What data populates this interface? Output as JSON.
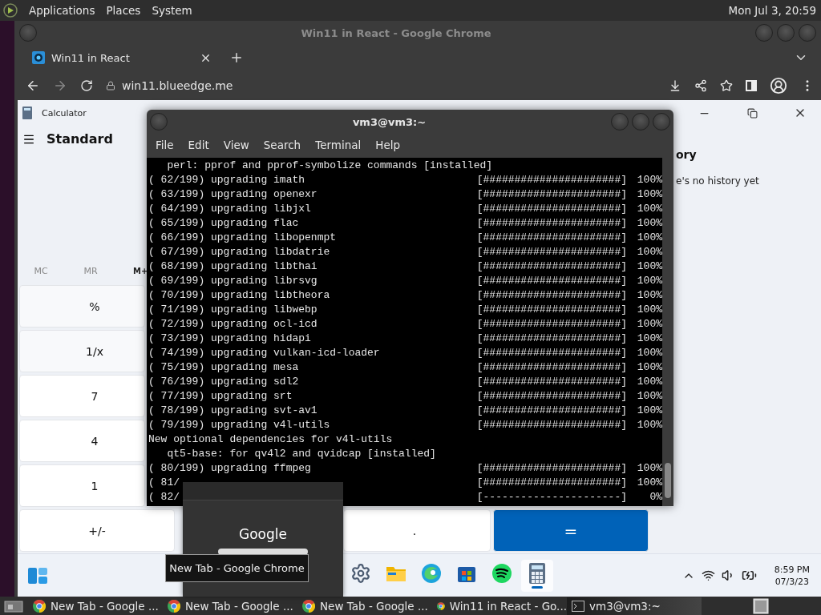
{
  "top_panel": {
    "menus": [
      "Applications",
      "Places",
      "System"
    ],
    "clock": "Mon Jul 3, 20:59"
  },
  "browser": {
    "window_title": "Win11 in React - Google Chrome",
    "tabs": [
      {
        "title": "Win11 in React",
        "selected": true
      }
    ],
    "url": "win11.blueedge.me"
  },
  "calculator": {
    "title": "Calculator",
    "mode": "Standard",
    "memory": [
      "MC",
      "MR",
      "M+"
    ],
    "rows": [
      {
        "keys": [
          {
            "label": "%",
            "kind": "function"
          }
        ]
      },
      {
        "keys": [
          {
            "label": "1/x",
            "kind": "function"
          }
        ]
      },
      {
        "keys": [
          {
            "label": "7",
            "kind": "digit"
          }
        ]
      },
      {
        "keys": [
          {
            "label": "4",
            "kind": "digit"
          }
        ]
      },
      {
        "keys": [
          {
            "label": "1",
            "kind": "digit"
          }
        ]
      },
      {
        "keys": [
          {
            "label": "+/-",
            "kind": "digit"
          },
          {
            "label": ".",
            "kind": "digit"
          },
          {
            "label": "=",
            "kind": "equals"
          }
        ]
      }
    ],
    "history": {
      "title": "ory",
      "message": "e's no history yet"
    }
  },
  "taskbar": {
    "apps": [
      {
        "kind": "settings",
        "active": false
      },
      {
        "kind": "files",
        "active": false
      },
      {
        "kind": "edge",
        "active": false
      },
      {
        "kind": "store",
        "active": false
      },
      {
        "kind": "spotify",
        "active": false
      },
      {
        "kind": "calculator",
        "active": true
      }
    ],
    "time": "8:59 PM",
    "date": "07/3/23"
  },
  "terminal": {
    "title": "vm3@vm3:~",
    "menus": [
      "File",
      "Edit",
      "View",
      "Search",
      "Terminal",
      "Help"
    ],
    "lines": [
      {
        "kind": "plain",
        "text": "   perl: pprof and pprof-symbolize commands [installed]"
      },
      {
        "kind": "progress",
        "text": "( 62/199) upgrading imath",
        "bar": "[######################]",
        "percent": "100%"
      },
      {
        "kind": "progress",
        "text": "( 63/199) upgrading openexr",
        "bar": "[######################]",
        "percent": "100%"
      },
      {
        "kind": "progress",
        "text": "( 64/199) upgrading libjxl",
        "bar": "[######################]",
        "percent": "100%"
      },
      {
        "kind": "progress",
        "text": "( 65/199) upgrading flac",
        "bar": "[######################]",
        "percent": "100%"
      },
      {
        "kind": "progress",
        "text": "( 66/199) upgrading libopenmpt",
        "bar": "[######################]",
        "percent": "100%"
      },
      {
        "kind": "progress",
        "text": "( 67/199) upgrading libdatrie",
        "bar": "[######################]",
        "percent": "100%"
      },
      {
        "kind": "progress",
        "text": "( 68/199) upgrading libthai",
        "bar": "[######################]",
        "percent": "100%"
      },
      {
        "kind": "progress",
        "text": "( 69/199) upgrading librsvg",
        "bar": "[######################]",
        "percent": "100%"
      },
      {
        "kind": "progress",
        "text": "( 70/199) upgrading libtheora",
        "bar": "[######################]",
        "percent": "100%"
      },
      {
        "kind": "progress",
        "text": "( 71/199) upgrading libwebp",
        "bar": "[######################]",
        "percent": "100%"
      },
      {
        "kind": "progress",
        "text": "( 72/199) upgrading ocl-icd",
        "bar": "[######################]",
        "percent": "100%"
      },
      {
        "kind": "progress",
        "text": "( 73/199) upgrading hidapi",
        "bar": "[######################]",
        "percent": "100%"
      },
      {
        "kind": "progress",
        "text": "( 74/199) upgrading vulkan-icd-loader",
        "bar": "[######################]",
        "percent": "100%"
      },
      {
        "kind": "progress",
        "text": "( 75/199) upgrading mesa",
        "bar": "[######################]",
        "percent": "100%"
      },
      {
        "kind": "progress",
        "text": "( 76/199) upgrading sdl2",
        "bar": "[######################]",
        "percent": "100%"
      },
      {
        "kind": "progress",
        "text": "( 77/199) upgrading srt",
        "bar": "[######################]",
        "percent": "100%"
      },
      {
        "kind": "progress",
        "text": "( 78/199) upgrading svt-av1",
        "bar": "[######################]",
        "percent": "100%"
      },
      {
        "kind": "progress",
        "text": "( 79/199) upgrading v4l-utils",
        "bar": "[######################]",
        "percent": "100%"
      },
      {
        "kind": "plain",
        "text": "New optional dependencies for v4l-utils"
      },
      {
        "kind": "plain",
        "text": "   qt5-base: for qv4l2 and qvidcap [installed]"
      },
      {
        "kind": "progress",
        "text": "( 80/199) upgrading ffmpeg",
        "bar": "[######################]",
        "percent": "100%"
      },
      {
        "kind": "progress",
        "text": "( 81/",
        "bar": "[######################]",
        "percent": "100%"
      },
      {
        "kind": "progress",
        "text": "( 82/",
        "bar": "[----------------------]",
        "percent": "0%"
      }
    ]
  },
  "thumbnail": {
    "text": "Google"
  },
  "tooltip": "New Tab - Google Chrome",
  "bottom_panel": {
    "tasks": [
      {
        "kind": "chrome",
        "title": "New Tab - Google ...",
        "selected": false
      },
      {
        "kind": "chrome",
        "title": "New Tab - Google ...",
        "selected": false
      },
      {
        "kind": "chrome",
        "title": "New Tab - Google ...",
        "selected": false
      },
      {
        "kind": "chrome",
        "title": "Win11 in React - Go...",
        "selected": false
      },
      {
        "kind": "terminal",
        "title": "vm3@vm3:~",
        "selected": true
      }
    ]
  }
}
